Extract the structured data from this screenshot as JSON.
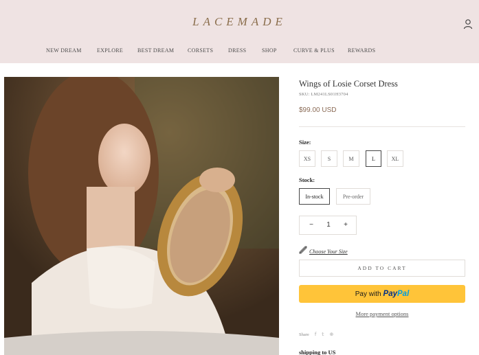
{
  "brand": {
    "logo_text": "LACEMADE"
  },
  "header": {
    "nav": [
      "NEW DREAM",
      "EXPLORE",
      "BEST DREAM",
      "CORSETS",
      "DRESS",
      "SHOP",
      "CURVE & PLUS",
      "REWARDS"
    ],
    "account_icon": "user-icon"
  },
  "product": {
    "image_alt": "",
    "title": "Wings of Losie Corset Dress",
    "sku": "SKU: LM241LS01H3704",
    "price": "$99.00 USD",
    "size_label": "Size:",
    "sizes": [
      "XS",
      "S",
      "M",
      "L",
      "XL"
    ],
    "selected_size": "L",
    "stock_label": "Stock:",
    "stock_options": [
      "In-stock",
      "Pre-order"
    ],
    "selected_stock": "In-stock",
    "quantity": {
      "minus": "−",
      "value": "1",
      "plus": "+"
    },
    "size_guide": "Choose Your Size",
    "add_to_cart": "ADD TO CART",
    "paypal": {
      "prefix": "Pay with",
      "pay": "Pay",
      "pal": "Pal"
    },
    "more_payment": "More payment options",
    "share_label": "Share",
    "share_icons": [
      "facebook-icon",
      "twitter-icon",
      "pinterest-icon"
    ],
    "shipping_title": "shipping to US"
  },
  "colors": {
    "header_bg": "#efe3e3",
    "paypal_yellow": "#ffc439",
    "accent_price": "#8a6a55"
  }
}
